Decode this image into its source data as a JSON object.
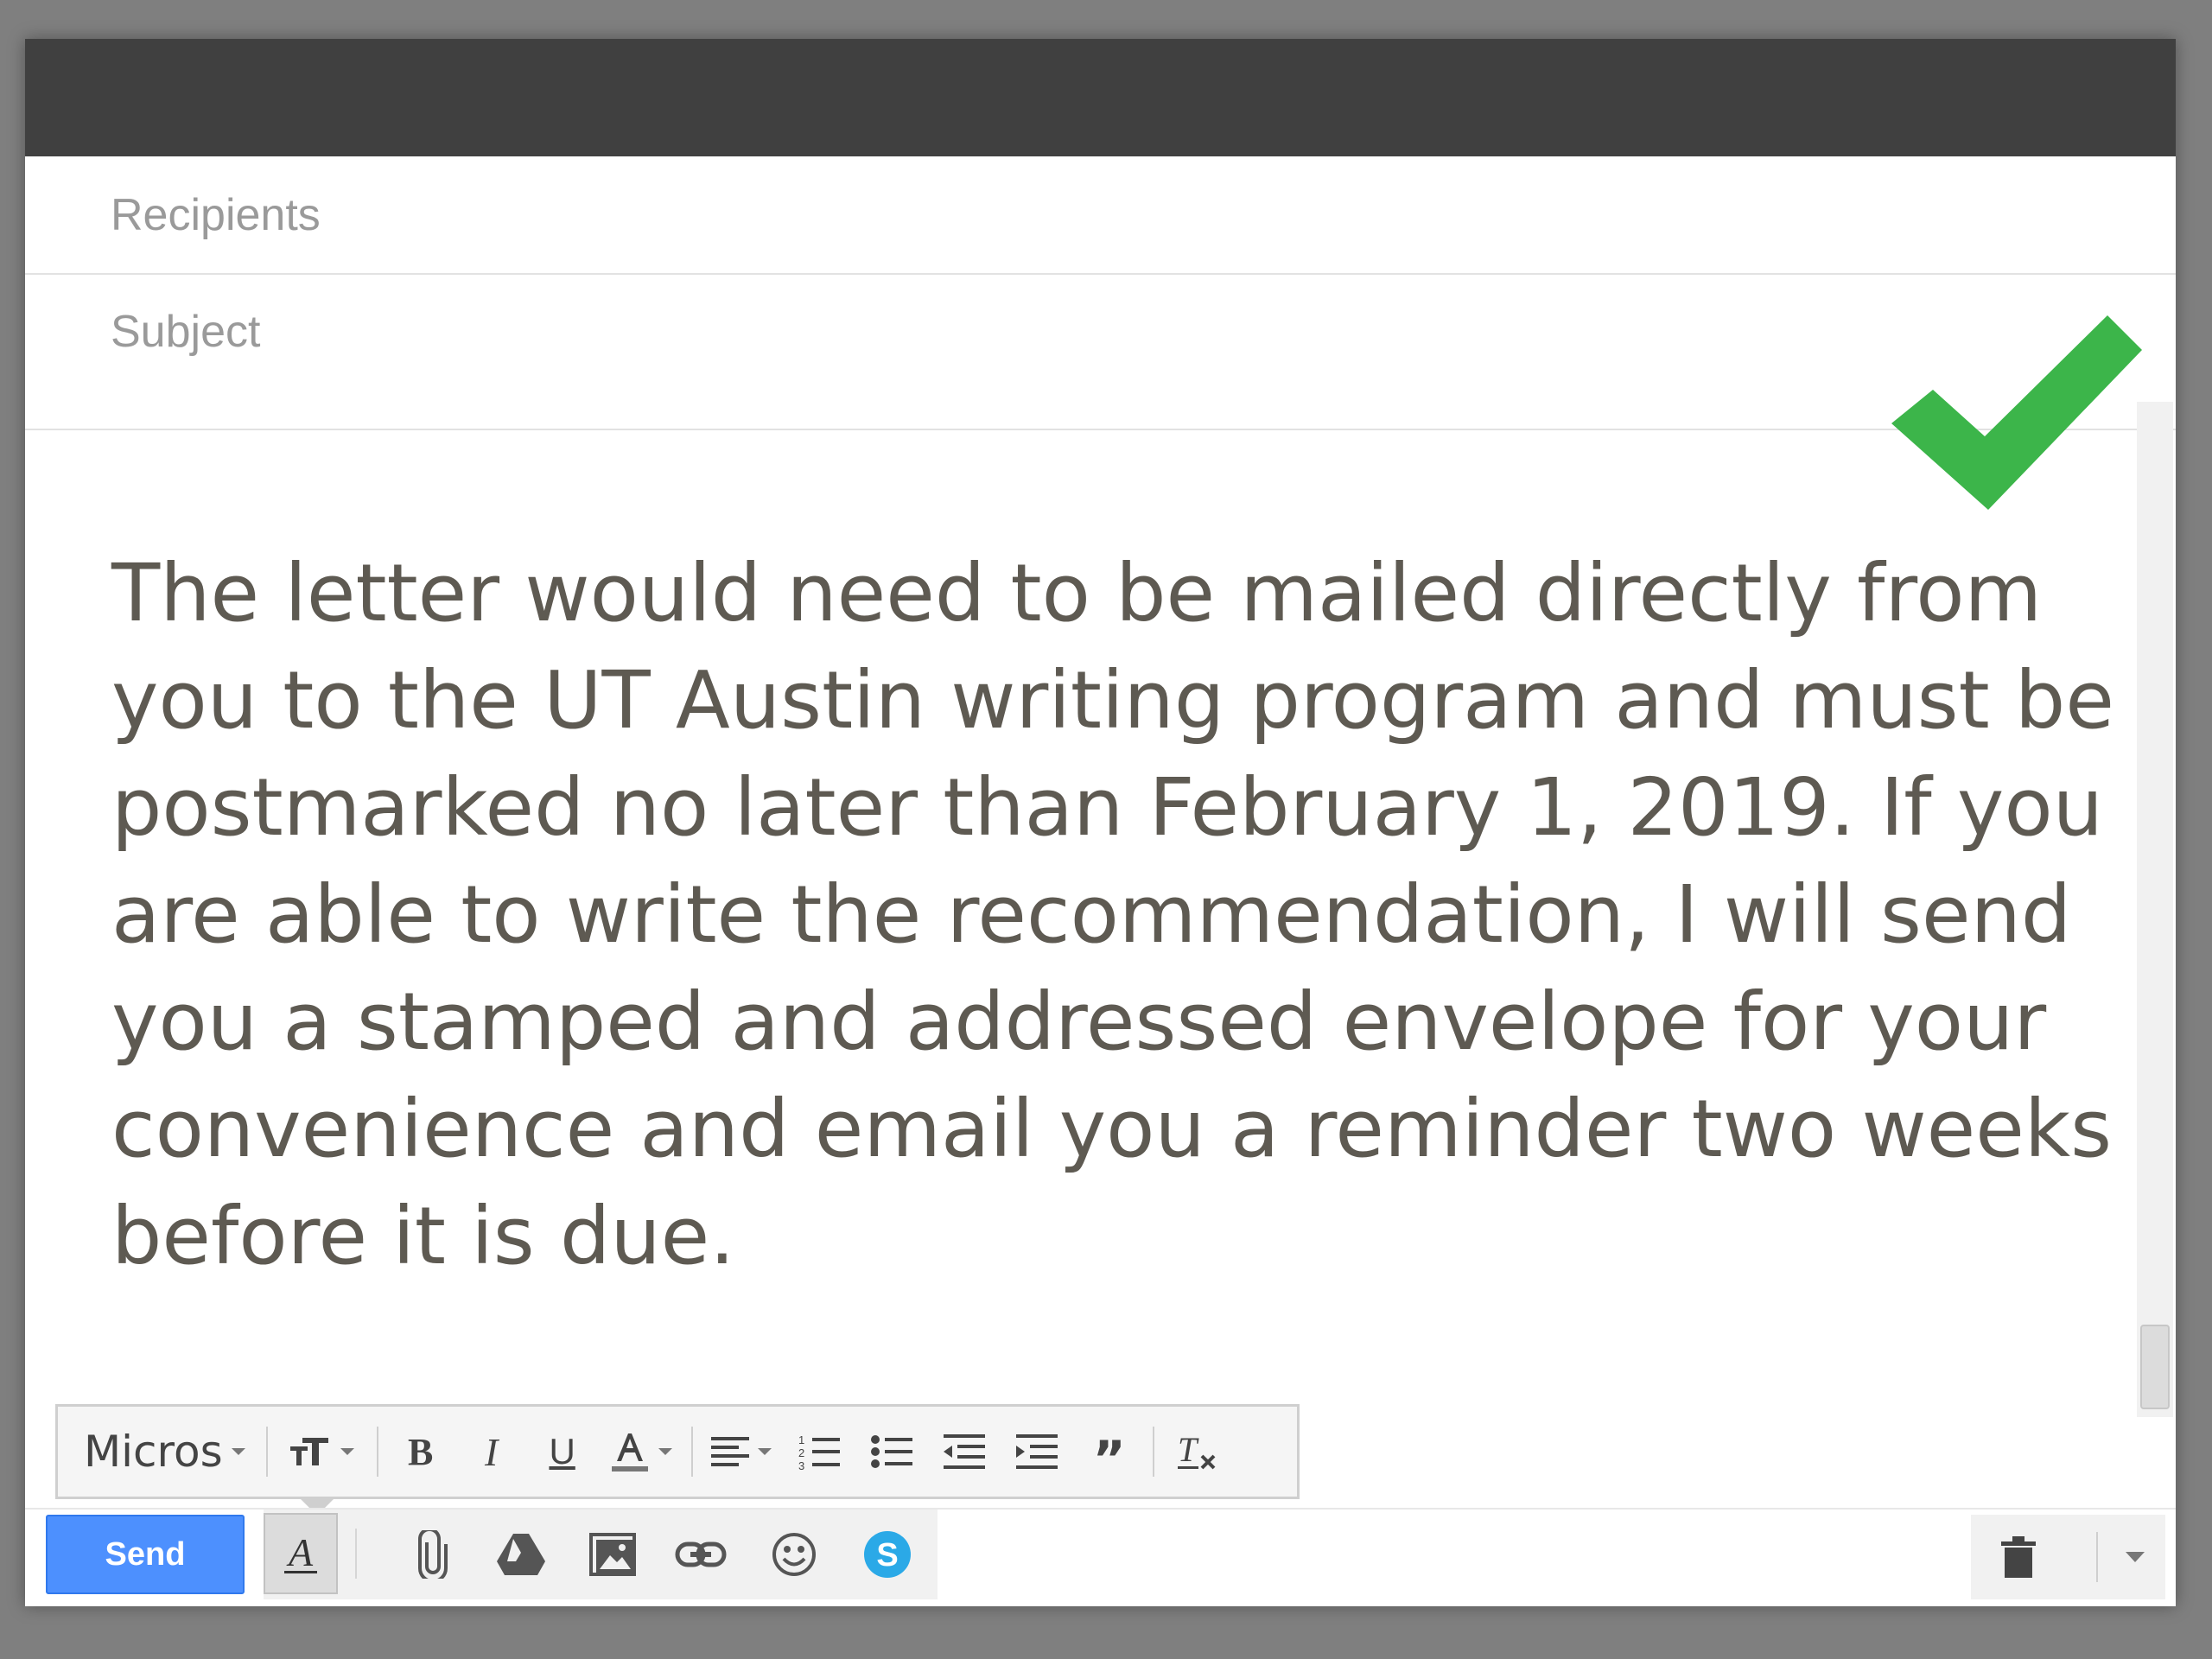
{
  "compose": {
    "recipients_placeholder": "Recipients",
    "subject_placeholder": "Subject",
    "body_text": "The letter would need to be mailed directly from you to the UT Austin writing program and must be postmarked no later than February 1, 2019. If you are able to write the recommendation, I will send you a stamped and addressed envelope for your convenience and email you a reminder two weeks before it is due."
  },
  "format_toolbar": {
    "font_value": "Micros",
    "buttons": [
      "font-size-icon",
      "bold-icon",
      "italic-icon",
      "underline-icon",
      "text-color-icon",
      "align-icon",
      "numbered-list-icon",
      "bulleted-list-icon",
      "indent-less-icon",
      "indent-more-icon",
      "quote-icon",
      "remove-formatting-icon"
    ]
  },
  "bottom_bar": {
    "send_label": "Send",
    "icons": [
      "formatting-icon",
      "attach-icon",
      "drive-icon",
      "photo-icon",
      "link-icon",
      "emoji-icon",
      "skype-icon",
      "trash-icon",
      "more-options-icon"
    ]
  },
  "colors": {
    "accent": "#4d90fe",
    "checkmark": "#3cb54a",
    "header": "#404040",
    "body_text": "#5e5a52",
    "skype": "#2ba9e7"
  }
}
